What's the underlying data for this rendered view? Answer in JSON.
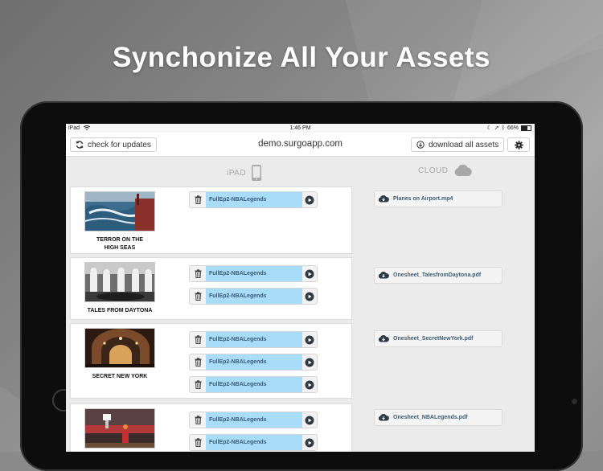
{
  "headline": "Synchonize All Your Assets",
  "status_bar": {
    "device": "iPad",
    "time": "1:46 PM",
    "battery": "66%",
    "battery_level": 0.66
  },
  "toolbar": {
    "check_updates_label": "check for updates",
    "domain": "demo.surgoapp.com",
    "download_all_label": "download all assets"
  },
  "columns": {
    "device": "iPAD",
    "cloud": "CLOUD"
  },
  "assets": [
    {
      "title_line1": "TERROR ON THE",
      "title_line2": "HIGH SEAS",
      "device_files": [
        "FullEp2-NBALegends"
      ],
      "cloud_files": [
        "Planes on Airport.mp4"
      ]
    },
    {
      "title_line1": "TALES FROM DAYTONA",
      "title_line2": "",
      "device_files": [
        "FullEp2-NBALegends",
        "FullEp2-NBALegends"
      ],
      "cloud_files": [
        "Onesheet_TalesfromDaytona.pdf"
      ]
    },
    {
      "title_line1": "SECRET NEW YORK",
      "title_line2": "",
      "device_files": [
        "FullEp2-NBALegends",
        "FullEp2-NBALegends",
        "FullEp2-NBALegends"
      ],
      "cloud_files": [
        "Onesheet_SecretNewYork.pdf"
      ]
    },
    {
      "title_line1": "",
      "title_line2": "",
      "device_files": [
        "FullEp2-NBALegends",
        "FullEp2-NBALegends"
      ],
      "cloud_files": [
        "Onesheet_NBALegends.pdf"
      ]
    }
  ],
  "colors": {
    "accent_file": "#a8dcf9",
    "dark_icon": "#2f3a44"
  }
}
